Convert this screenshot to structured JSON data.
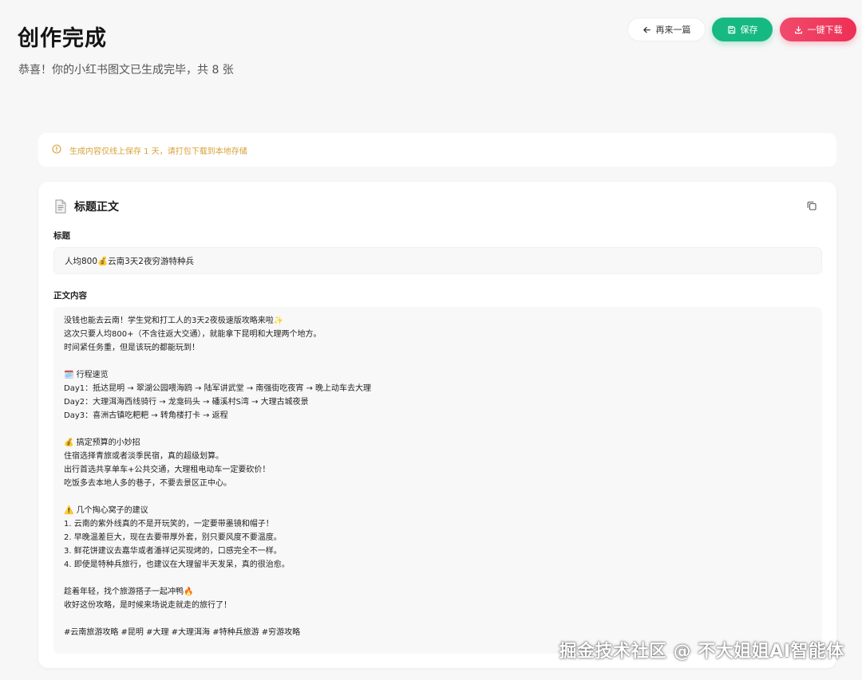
{
  "header": {
    "title": "创作完成",
    "subtitle": "恭喜！你的小红书图文已生成完毕，共 8 张"
  },
  "actions": {
    "back_label": "再来一篇",
    "save_label": "保存",
    "download_label": "一键下载"
  },
  "notice": {
    "text": "生成内容仅线上保存 1 天，请打包下载到本地存储"
  },
  "card": {
    "title": "标题正文",
    "title_field_label": "标题",
    "title_value": "人均800💰云南3天2夜穷游特种兵",
    "body_field_label": "正文内容",
    "body_lines": [
      "没钱也能去云南！学生党和打工人的3天2夜极速版攻略来啦✨",
      "这次只要人均800+（不含往返大交通），就能拿下昆明和大理两个地方。",
      "时间紧任务重，但是该玩的都能玩到！",
      "",
      "🗓️ 行程速览",
      "Day1：抵达昆明 → 翠湖公园喂海鸥 → 陆军讲武堂 → 南强街吃夜宵 → 晚上动车去大理",
      "Day2：大理洱海西线骑行 → 龙龛码头 → 磻溪村S湾 → 大理古城夜景",
      "Day3：喜洲古镇吃粑粑 → 转角楼打卡 → 返程",
      "",
      "💰 搞定预算的小妙招",
      "住宿选择青旅或者淡季民宿，真的超级划算。",
      "出行首选共享单车+公共交通，大理租电动车一定要砍价！",
      "吃饭多去本地人多的巷子，不要去景区正中心。",
      "",
      "⚠️ 几个掏心窝子的建议",
      "1. 云南的紫外线真的不是开玩笑的，一定要带墨镜和帽子！",
      "2. 早晚温差巨大，现在去要带厚外套，别只要风度不要温度。",
      "3. 鲜花饼建议去嘉华或者潘祥记买现烤的，口感完全不一样。",
      "4. 即使是特种兵旅行，也建议在大理留半天发呆，真的很治愈。",
      "",
      "趁着年轻，找个旅游搭子一起冲鸭🔥",
      "收好这份攻略，是时候来场说走就走的旅行了！",
      "",
      "#云南旅游攻略 #昆明 #大理 #大理洱海 #特种兵旅游 #穷游攻略"
    ]
  },
  "watermark": "掘金技术社区 @ 不大姐姐AI智能体",
  "colors": {
    "save": "#17b982",
    "download": "#ee2f55",
    "notice": "#d8a23a",
    "background": "#f7f7f7"
  },
  "icons": {
    "back": "arrow-left-icon",
    "save": "floppy-disk-icon",
    "download": "download-icon",
    "notice": "info-circle-icon",
    "card": "document-icon",
    "copy": "copy-icon"
  }
}
